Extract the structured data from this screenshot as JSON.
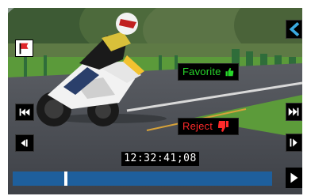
{
  "player": {
    "timecode": "12:32:41;08",
    "progress_fraction": 0.205,
    "favorite": {
      "label": "Favorite",
      "color": "#27d62a",
      "icon": "thumbs-up-icon"
    },
    "reject": {
      "label": "Reject",
      "color": "#ff2a2a",
      "icon": "thumbs-down-icon"
    }
  },
  "colors": {
    "track": "#1e5f9c",
    "back_button": "#3aa9e0",
    "flag_icon": "#e0262a"
  },
  "icons": {
    "flag": "flag-icon",
    "back": "chevron-left-icon",
    "skip_start": "skip-to-start-icon",
    "skip_end": "skip-to-end-icon",
    "step_back": "step-back-icon",
    "step_forward": "step-forward-icon",
    "play": "play-icon"
  }
}
